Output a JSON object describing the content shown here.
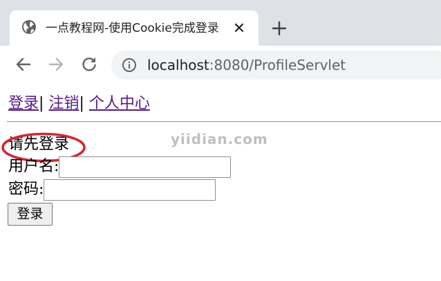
{
  "browser": {
    "tab": {
      "title": "一点教程网-使用Cookie完成登录",
      "favicon": "globe-icon",
      "close_icon": "close-icon"
    },
    "new_tab_icon": "plus-icon",
    "toolbar": {
      "back_icon": "arrow-left-icon",
      "forward_icon": "arrow-right-icon",
      "reload_icon": "reload-icon",
      "site_info_icon": "info-icon"
    },
    "address": {
      "host": "localhost",
      "rest": ":8080/ProfileServlet"
    }
  },
  "page": {
    "nav": {
      "login": "登录",
      "sep1": "|",
      "logout": "注销",
      "sep2": "|",
      "profile": "个人中心"
    },
    "notice": "请先登录",
    "watermark": "yiidian.com",
    "form": {
      "username_label": "用户名:",
      "username_value": "",
      "password_label": "密码:",
      "password_value": "",
      "submit_label": "登录"
    }
  },
  "colors": {
    "tabstrip_bg": "#dee1e6",
    "omnibox_bg": "#f1f3f4",
    "visited_link": "#551a8b",
    "annotation_red": "#e0202a"
  }
}
